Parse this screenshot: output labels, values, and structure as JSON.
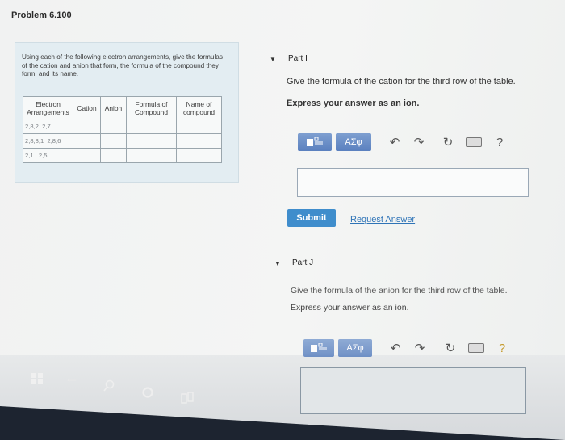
{
  "problem": {
    "title": "Problem 6.100",
    "instructions": "Using each of the following electron arrangements, give the formulas of the cation and anion that form, the formula of the compound they form, and its name.",
    "table": {
      "headers": [
        "Electron Arrangements",
        "Cation",
        "Anion",
        "Formula of Compound",
        "Name of compound"
      ],
      "rows": [
        [
          "2,8,2",
          "2,7"
        ],
        [
          "2,8,8,1",
          "2,8,6"
        ],
        [
          "2,1",
          "2,5"
        ]
      ]
    }
  },
  "part_i": {
    "label": "Part I",
    "question": "Give the formula of the cation for the third row of the table.",
    "express": "Express your answer as an ion.",
    "greek_button": "ΑΣφ",
    "help_button": "?",
    "submit_label": "Submit",
    "request_label": "Request Answer"
  },
  "part_j": {
    "label": "Part J",
    "question": "Give the formula of the anion for the third row of the table.",
    "express": "Express your answer as an ion.",
    "greek_button": "ΑΣφ",
    "help_button": "?"
  }
}
